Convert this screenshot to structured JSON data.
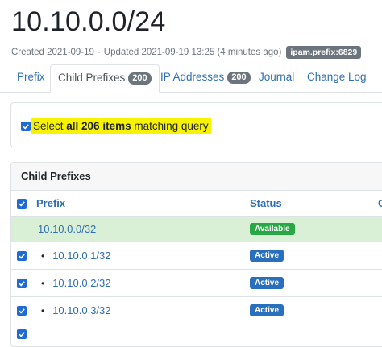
{
  "page": {
    "title": "10.10.0.0/24",
    "created": "Created 2021-09-19",
    "separator": "·",
    "updated": "Updated 2021-09-19 13:25 (4 minutes ago)",
    "object_id": "ipam.prefix:6829"
  },
  "tabs": [
    {
      "label": "Prefix",
      "count": null,
      "active": false
    },
    {
      "label": "Child Prefixes",
      "count": "200",
      "active": true
    },
    {
      "label": "IP Addresses",
      "count": "200",
      "active": false
    },
    {
      "label": "Journal",
      "count": null,
      "active": false
    },
    {
      "label": "Change Log",
      "count": null,
      "active": false
    }
  ],
  "select_all": {
    "prefix": "Select ",
    "bold": "all 206 items",
    "suffix": " matching query",
    "checked": true
  },
  "panel": {
    "title": "Child Prefixes",
    "columns": [
      "Prefix",
      "Status",
      "C"
    ],
    "rows": [
      {
        "prefix": "10.10.0.0/32",
        "status": "Available",
        "checkbox": false,
        "bullet": false,
        "more": "",
        "status_color": "#28a745"
      },
      {
        "prefix": "10.10.0.1/32",
        "status": "Active",
        "checkbox": true,
        "bullet": true,
        "more": "",
        "status_color": "#2a6fbd"
      },
      {
        "prefix": "10.10.0.2/32",
        "status": "Active",
        "checkbox": true,
        "bullet": true,
        "more": "",
        "status_color": "#2a6fbd"
      },
      {
        "prefix": "10.10.0.3/32",
        "status": "Active",
        "checkbox": true,
        "bullet": true,
        "more": "",
        "status_color": "#2a6fbd"
      }
    ]
  },
  "colors": {
    "link": "#2f6fb1",
    "highlight": "#f7f300",
    "checkbox": "#1f6ad4",
    "available_row_bg": "#d9efd6"
  },
  "icons": {
    "checkbox": "check-icon",
    "bullet": "bullet-icon"
  }
}
